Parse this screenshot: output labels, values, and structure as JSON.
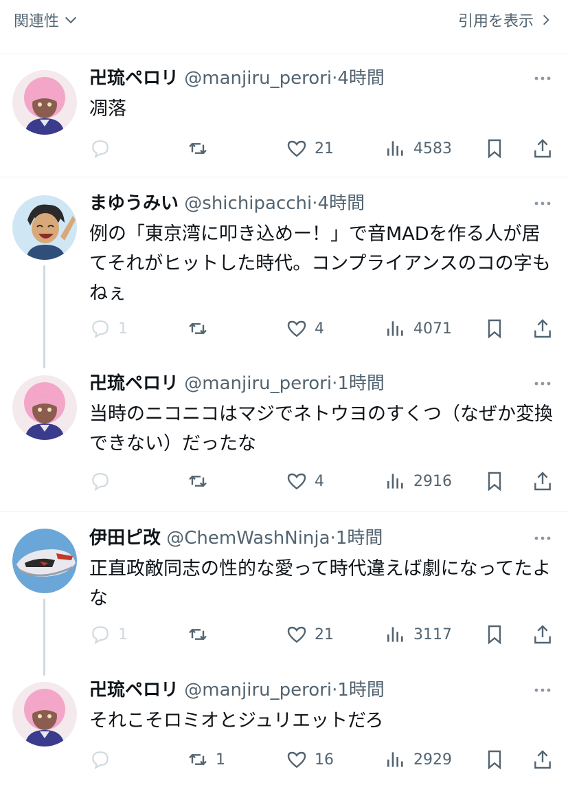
{
  "header": {
    "sort_label": "関連性",
    "quotes_label": "引用を表示"
  },
  "tweets": [
    {
      "name": "卍琉ペロリ",
      "handle": "@manjiru_perori",
      "separator": "·",
      "time": "4時間",
      "text": "凋落",
      "replies": "",
      "retweets": "",
      "likes": "21",
      "views": "4583",
      "avatar": "pink-hair-avatar"
    },
    {
      "name": "まゆうみい",
      "handle": "@shichipacchi",
      "separator": "·",
      "time": "4時間",
      "text": "例の「東京湾に叩き込めー！」で音MADを作る人が居てそれがヒットした時代。コンプライアンスのコの字もねぇ",
      "replies": "1",
      "retweets": "",
      "likes": "4",
      "views": "4071",
      "avatar": "laughing-boy-avatar"
    },
    {
      "name": "卍琉ペロリ",
      "handle": "@manjiru_perori",
      "separator": "·",
      "time": "1時間",
      "text": "当時のニコニコはマジでネトウヨのすくつ（なぜか変換できない）だったな",
      "replies": "",
      "retweets": "",
      "likes": "4",
      "views": "2916",
      "avatar": "pink-hair-avatar"
    },
    {
      "name": "伊田ピ改",
      "handle": "@ChemWashNinja",
      "separator": "·",
      "time": "1時間",
      "text": "正直政敵同志の性的な愛って時代違えば劇になってたよな",
      "replies": "1",
      "retweets": "",
      "likes": "21",
      "views": "3117",
      "avatar": "robot-face-avatar"
    },
    {
      "name": "卍琉ペロリ",
      "handle": "@manjiru_perori",
      "separator": "·",
      "time": "1時間",
      "text": "それこそロミオとジュリエットだろ",
      "replies": "",
      "retweets": "1",
      "likes": "16",
      "views": "2929",
      "avatar": "pink-hair-avatar"
    }
  ],
  "colors": {
    "text": "#0f1419",
    "secondary": "#536471",
    "divider": "#eff3f4",
    "thread_line": "#cfd9de"
  }
}
